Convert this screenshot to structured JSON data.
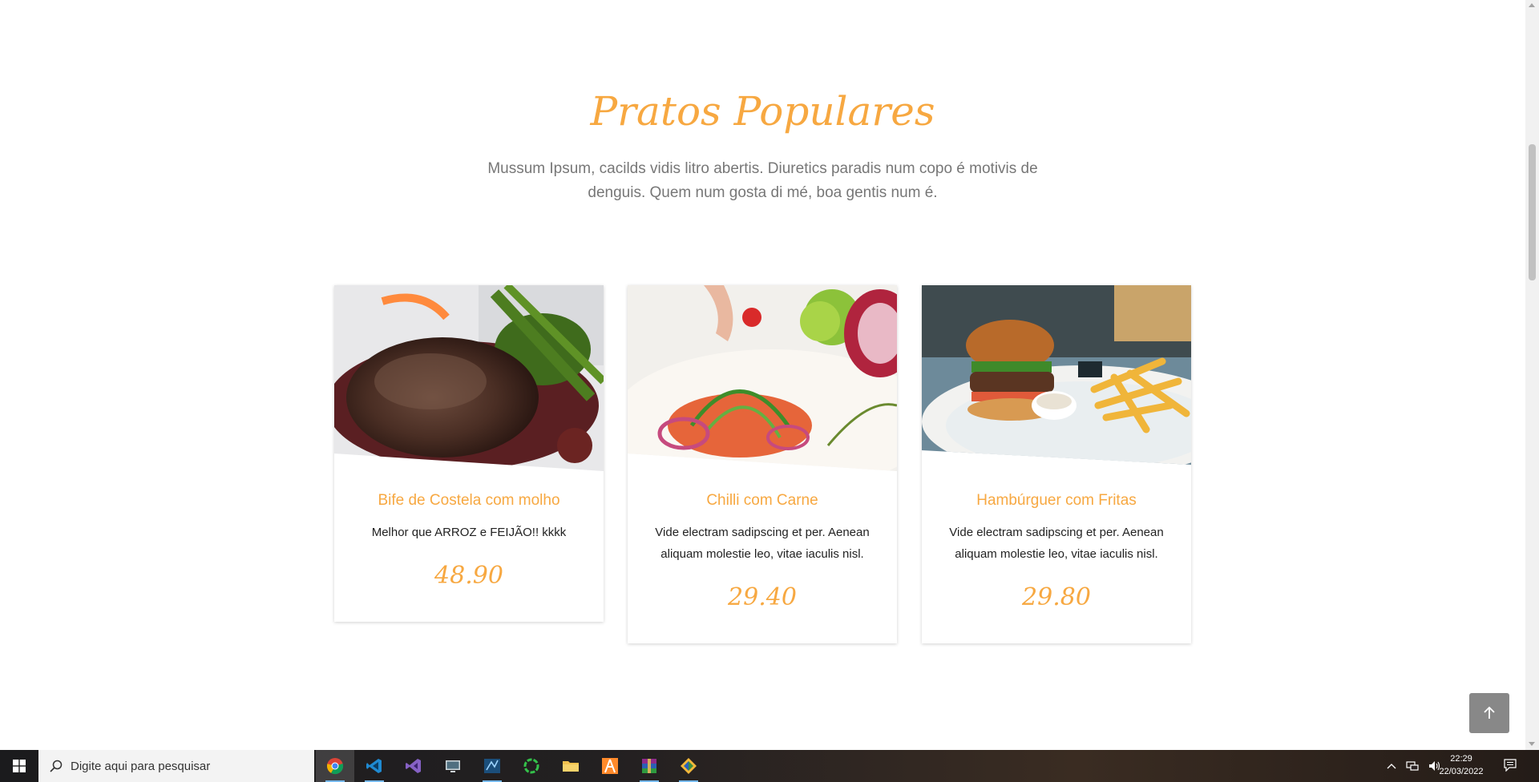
{
  "section": {
    "title": "Pratos Populares",
    "subtitle": "Mussum Ipsum, cacilds vidis litro abertis. Diuretics paradis num copo é motivis de denguis. Quem num gosta di mé, boa gentis num é."
  },
  "dishes": [
    {
      "name": "Bife de Costela com molho",
      "description": "Melhor que ARROZ e FEIJÃO!! kkkk",
      "price": "48.90"
    },
    {
      "name": "Chilli com Carne",
      "description": "Vide electram sadipscing et per. Aenean aliquam molestie leo, vitae iaculis nisl.",
      "price": "29.40"
    },
    {
      "name": "Hambúrguer com Fritas",
      "description": "Vide electram sadipscing et per. Aenean aliquam molestie leo, vitae iaculis nisl.",
      "price": "29.80"
    }
  ],
  "back_to_top": {
    "icon": "arrow-up-icon"
  },
  "colors": {
    "accent": "#f7a841",
    "subtitle": "#777777",
    "text": "#222222"
  },
  "taskbar": {
    "search_placeholder": "Digite aqui para pesquisar",
    "apps": [
      "chrome",
      "vscode",
      "visual-studio",
      "remote-desktop",
      "sql-server-management-studio",
      "circular-app",
      "file-explorer",
      "sublime-text",
      "winrar",
      "git-extensions"
    ],
    "clock": {
      "time": "22:29",
      "date": "22/03/2022"
    }
  }
}
